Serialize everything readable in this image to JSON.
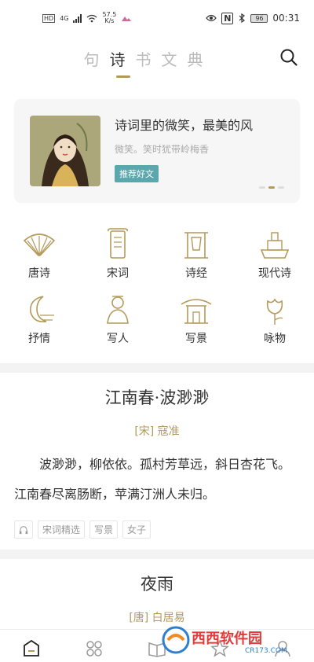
{
  "status": {
    "speed": "57.5",
    "speed_unit": "K/s",
    "battery": "96",
    "time": "00:31",
    "net": "4G"
  },
  "tabs": [
    "句",
    "诗",
    "书",
    "文",
    "典"
  ],
  "banner": {
    "title": "诗词里的微笑，最美的风",
    "subtitle": "微笑。笑时犹带岭梅香",
    "tag": "推荐好文"
  },
  "categories": [
    {
      "label": "唐诗",
      "icon": "fan-icon"
    },
    {
      "label": "宋词",
      "icon": "scroll-icon"
    },
    {
      "label": "诗经",
      "icon": "bell-stand-icon"
    },
    {
      "label": "现代诗",
      "icon": "ship-icon"
    },
    {
      "label": "抒情",
      "icon": "moon-icon"
    },
    {
      "label": "写人",
      "icon": "person-icon"
    },
    {
      "label": "写景",
      "icon": "pavilion-icon"
    },
    {
      "label": "咏物",
      "icon": "flower-icon"
    }
  ],
  "poem1": {
    "title": "江南春·波渺渺",
    "author": "[宋] 寇准",
    "body": "波渺渺，柳依依。孤村芳草远，斜日杏花飞。江南春尽离肠断，苹满汀洲人未归。",
    "tags": [
      "宋词精选",
      "写景",
      "女子"
    ]
  },
  "poem2": {
    "title": "夜雨",
    "author": "[唐] 白居易"
  },
  "watermark": {
    "text": "西西软件园",
    "domain": "CR173.COM"
  },
  "colors": {
    "accent": "#b49a5a",
    "tag_bg": "#5ba7ae"
  }
}
